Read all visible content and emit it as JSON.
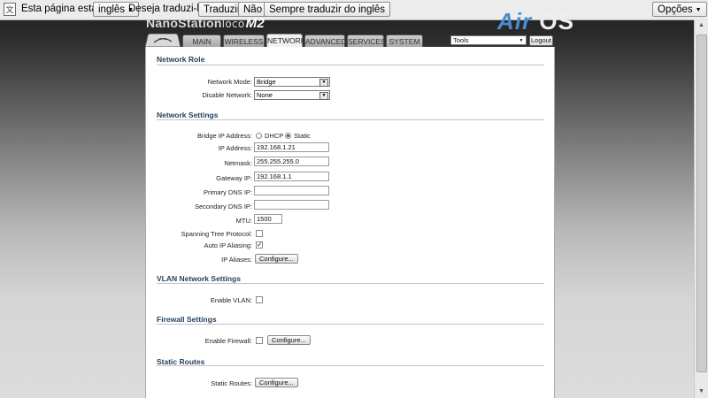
{
  "translate_bar": {
    "icon": "translate-icon",
    "prefix": "Esta página está em",
    "language": "inglês",
    "question": "Deseja traduzi-la?",
    "translate": "Traduzir",
    "no": "Não",
    "never": "Sempre traduzir do inglês",
    "options": "Opções"
  },
  "header": {
    "product": "NanoStation",
    "model_num": "loco",
    "model_suffix": "M2",
    "air": "Air",
    "os": "OS"
  },
  "nav": {
    "tabs": [
      {
        "label": "MAIN",
        "active": false
      },
      {
        "label": "WIRELESS",
        "active": false
      },
      {
        "label": "NETWORK",
        "active": true
      },
      {
        "label": "ADVANCED",
        "active": false
      },
      {
        "label": "SERVICES",
        "active": false
      },
      {
        "label": "SYSTEM",
        "active": false
      }
    ],
    "tools": "Tools",
    "logout": "Logout"
  },
  "network_role": {
    "heading": "Network Role",
    "network_mode_label": "Network Mode:",
    "network_mode_value": "Bridge",
    "disable_network_label": "Disable Network:",
    "disable_network_value": "None"
  },
  "network_settings": {
    "heading": "Network Settings",
    "bridge_ip_label": "Bridge IP Address:",
    "dhcp": "DHCP",
    "static": "Static",
    "ip_label": "IP Address:",
    "ip_value": "192.168.1.21",
    "netmask_label": "Netmask:",
    "netmask_value": "255.255.255.0",
    "gateway_label": "Gateway IP:",
    "gateway_value": "192.168.1.1",
    "primary_dns_label": "Primary DNS IP:",
    "primary_dns_value": "",
    "secondary_dns_label": "Secondary DNS IP:",
    "secondary_dns_value": "",
    "mtu_label": "MTU:",
    "mtu_value": "1500",
    "stp_label": "Spanning Tree Protocol:",
    "stp_checked": false,
    "alias_label": "Auto IP Aliasing:",
    "alias_checked": true,
    "ip_aliases_label": "IP Aliases:",
    "configure": "Configure..."
  },
  "vlan": {
    "heading": "VLAN Network Settings",
    "enable_label": "Enable VLAN:"
  },
  "firewall": {
    "heading": "Firewall Settings",
    "enable_label": "Enable Firewall:",
    "configure": "Configure..."
  },
  "static_routes": {
    "heading": "Static Routes",
    "label": "Static Routes:",
    "configure": "Configure..."
  }
}
